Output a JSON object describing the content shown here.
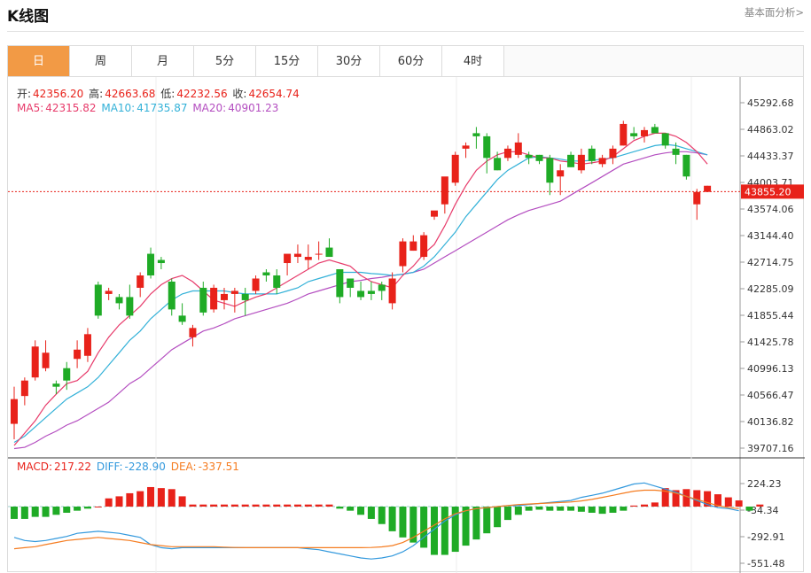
{
  "header": {
    "title": "K线图",
    "fundamental_link": "基本面分析>"
  },
  "tabs": [
    {
      "label": "日",
      "active": true
    },
    {
      "label": "周",
      "active": false
    },
    {
      "label": "月",
      "active": false
    },
    {
      "label": "5分",
      "active": false
    },
    {
      "label": "15分",
      "active": false
    },
    {
      "label": "30分",
      "active": false
    },
    {
      "label": "60分",
      "active": false
    },
    {
      "label": "4时",
      "active": false
    }
  ],
  "ohlc_info": {
    "open_label": "开:",
    "open": "42356.20",
    "high_label": "高:",
    "high": "42663.68",
    "low_label": "低:",
    "low": "42232.56",
    "close_label": "收:",
    "close": "42654.74"
  },
  "ma_info": {
    "ma5_label": "MA5:",
    "ma5": "42315.82",
    "ma10_label": "MA10:",
    "ma10": "41735.87",
    "ma20_label": "MA20:",
    "ma20": "40901.23"
  },
  "macd_info": {
    "macd_label": "MACD:",
    "macd": "217.22",
    "diff_label": "DIFF:",
    "diff": "-228.90",
    "dea_label": "DEA:",
    "dea": "-337.51"
  },
  "colors": {
    "up": "#e8221a",
    "down": "#1fab26",
    "ma5": "#e73b6b",
    "ma10": "#33b1d8",
    "ma20": "#b44ec0",
    "diff": "#3399dd",
    "dea": "#f57c20",
    "accent": "#f29a45"
  },
  "chart_data": [
    {
      "type": "candlestick",
      "price_ticks": [
        "45292.68",
        "44863.02",
        "44433.37",
        "44003.71",
        "43574.06",
        "43144.40",
        "42714.75",
        "42285.09",
        "41855.44",
        "41425.78",
        "40996.13",
        "40566.47",
        "40136.82",
        "39707.16"
      ],
      "ylim": [
        39707.16,
        45292.68
      ],
      "current_price": "43855.20",
      "candles": [
        [
          40100,
          40700,
          39850,
          40500
        ],
        [
          40550,
          40850,
          40400,
          40800
        ],
        [
          40850,
          41450,
          40800,
          41350
        ],
        [
          41000,
          41450,
          40950,
          41250
        ],
        [
          40750,
          40800,
          40580,
          40700
        ],
        [
          41000,
          41100,
          40650,
          40800
        ],
        [
          41150,
          41450,
          41000,
          41300
        ],
        [
          41200,
          41650,
          41100,
          41550
        ],
        [
          42350,
          42400,
          41800,
          41850
        ],
        [
          42200,
          42300,
          42100,
          42250
        ],
        [
          42150,
          42200,
          41950,
          42050
        ],
        [
          42150,
          42350,
          41800,
          41850
        ],
        [
          42300,
          42550,
          42150,
          42500
        ],
        [
          42850,
          42950,
          42450,
          42500
        ],
        [
          42750,
          42800,
          42600,
          42700
        ],
        [
          42400,
          42450,
          41850,
          41950
        ],
        [
          41850,
          42050,
          41700,
          41750
        ],
        [
          41500,
          41700,
          41350,
          41650
        ],
        [
          42300,
          42400,
          41850,
          41900
        ],
        [
          41950,
          42350,
          41900,
          42300
        ],
        [
          42100,
          42300,
          41950,
          42200
        ],
        [
          42200,
          42300,
          41900,
          42250
        ],
        [
          42200,
          42300,
          41850,
          42100
        ],
        [
          42250,
          42500,
          42200,
          42450
        ],
        [
          42550,
          42600,
          42400,
          42500
        ],
        [
          42500,
          42600,
          42200,
          42300
        ],
        [
          42700,
          42750,
          42500,
          42850
        ],
        [
          42800,
          43000,
          42700,
          42850
        ],
        [
          42750,
          43000,
          42600,
          42800
        ],
        [
          42850,
          43050,
          42750,
          42850
        ],
        [
          42950,
          43100,
          42900,
          42800
        ],
        [
          42600,
          42600,
          42050,
          42150
        ],
        [
          42450,
          42450,
          42150,
          42300
        ],
        [
          42250,
          42400,
          42100,
          42150
        ],
        [
          42250,
          42400,
          42100,
          42200
        ],
        [
          42350,
          42400,
          42100,
          42250
        ],
        [
          42050,
          42550,
          41950,
          42450
        ],
        [
          42650,
          43100,
          42550,
          43050
        ],
        [
          42900,
          43150,
          42900,
          43050
        ],
        [
          42800,
          43200,
          42750,
          43150
        ],
        [
          43450,
          43500,
          43400,
          43550
        ],
        [
          43650,
          43750,
          43500,
          44100
        ],
        [
          44000,
          44500,
          43950,
          44450
        ],
        [
          44550,
          44650,
          44400,
          44600
        ],
        [
          44800,
          44900,
          44550,
          44750
        ],
        [
          44750,
          44800,
          44150,
          44400
        ],
        [
          44400,
          44500,
          44200,
          44200
        ],
        [
          44400,
          44600,
          44350,
          44550
        ],
        [
          44450,
          44800,
          44400,
          44650
        ],
        [
          44450,
          44500,
          44300,
          44400
        ],
        [
          44450,
          44450,
          44300,
          44350
        ],
        [
          44400,
          44450,
          43800,
          44000
        ],
        [
          44100,
          44300,
          43800,
          44200
        ],
        [
          44450,
          44500,
          44250,
          44250
        ],
        [
          44200,
          44550,
          44150,
          44450
        ],
        [
          44550,
          44600,
          44300,
          44350
        ],
        [
          44300,
          44450,
          44250,
          44400
        ],
        [
          44400,
          44600,
          44300,
          44550
        ],
        [
          44600,
          45000,
          44600,
          44950
        ],
        [
          44800,
          44900,
          44700,
          44750
        ],
        [
          44750,
          44900,
          44650,
          44850
        ],
        [
          44900,
          44950,
          44800,
          44800
        ],
        [
          44800,
          44800,
          44550,
          44600
        ],
        [
          44550,
          44650,
          44300,
          44450
        ],
        [
          44450,
          44450,
          44050,
          44100
        ],
        [
          43650,
          43900,
          43400,
          43850
        ],
        [
          43850,
          43950,
          43850,
          43950
        ]
      ],
      "ma5": [
        39750,
        39950,
        40150,
        40400,
        40580,
        40750,
        40800,
        40950,
        41250,
        41500,
        41700,
        41850,
        42000,
        42200,
        42350,
        42450,
        42500,
        42400,
        42250,
        42100,
        42050,
        42000,
        42080,
        42150,
        42200,
        42300,
        42400,
        42500,
        42600,
        42700,
        42750,
        42700,
        42650,
        42500,
        42400,
        42350,
        42300,
        42500,
        42650,
        42850,
        43000,
        43300,
        43650,
        43950,
        44200,
        44350,
        44450,
        44500,
        44500,
        44450,
        44400,
        44400,
        44350,
        44330,
        44300,
        44320,
        44350,
        44420,
        44550,
        44680,
        44750,
        44800,
        44800,
        44750,
        44650,
        44500,
        44300
      ],
      "ma10": [
        39800,
        39900,
        40050,
        40200,
        40350,
        40500,
        40600,
        40700,
        40850,
        41050,
        41250,
        41450,
        41600,
        41800,
        41950,
        42100,
        42200,
        42250,
        42250,
        42250,
        42250,
        42220,
        42200,
        42200,
        42200,
        42200,
        42250,
        42300,
        42400,
        42450,
        42500,
        42550,
        42550,
        42550,
        42530,
        42520,
        42500,
        42520,
        42550,
        42650,
        42800,
        43000,
        43200,
        43450,
        43650,
        43850,
        44050,
        44200,
        44300,
        44400,
        44420,
        44400,
        44380,
        44350,
        44350,
        44360,
        44380,
        44400,
        44450,
        44500,
        44550,
        44600,
        44620,
        44600,
        44550,
        44500,
        44450
      ],
      "ma20": [
        39700,
        39720,
        39800,
        39900,
        39980,
        40080,
        40150,
        40250,
        40350,
        40450,
        40600,
        40750,
        40850,
        41000,
        41150,
        41300,
        41400,
        41500,
        41600,
        41650,
        41720,
        41800,
        41850,
        41900,
        41950,
        42000,
        42050,
        42120,
        42200,
        42250,
        42300,
        42350,
        42400,
        42420,
        42450,
        42470,
        42500,
        42520,
        42550,
        42600,
        42700,
        42800,
        42900,
        43000,
        43100,
        43200,
        43300,
        43400,
        43480,
        43550,
        43600,
        43650,
        43700,
        43800,
        43900,
        44000,
        44100,
        44200,
        44300,
        44350,
        44400,
        44450,
        44480,
        44500,
        44500,
        44480,
        44450
      ]
    },
    {
      "type": "macd",
      "ticks": [
        "224.23",
        "-34.34",
        "-292.91",
        "-551.48"
      ],
      "ylim": [
        -551.48,
        224.23
      ],
      "macd": [
        -120,
        -120,
        -100,
        -100,
        -80,
        -60,
        -40,
        -20,
        0,
        80,
        100,
        130,
        150,
        190,
        180,
        170,
        100,
        20,
        20,
        20,
        20,
        20,
        20,
        20,
        20,
        20,
        20,
        20,
        20,
        20,
        20,
        -20,
        -40,
        -80,
        -120,
        -170,
        -240,
        -300,
        -350,
        -400,
        -470,
        -470,
        -440,
        -380,
        -320,
        -260,
        -200,
        -130,
        -80,
        -40,
        -30,
        -40,
        -40,
        -40,
        -50,
        -60,
        -70,
        -60,
        -40,
        10,
        20,
        40,
        180,
        160,
        170,
        160,
        150,
        120,
        90,
        60,
        -40,
        20
      ],
      "diff": [
        -300,
        -330,
        -340,
        -330,
        -310,
        -290,
        -260,
        -250,
        -240,
        -250,
        -260,
        -280,
        -300,
        -370,
        -400,
        -410,
        -400,
        -400,
        -400,
        -400,
        -400,
        -400,
        -400,
        -400,
        -400,
        -400,
        -400,
        -400,
        -410,
        -420,
        -440,
        -460,
        -480,
        -500,
        -510,
        -500,
        -480,
        -440,
        -380,
        -300,
        -220,
        -140,
        -80,
        -40,
        -20,
        -10,
        0,
        10,
        10,
        20,
        30,
        40,
        50,
        60,
        90,
        110,
        130,
        160,
        190,
        220,
        230,
        200,
        170,
        140,
        100,
        60,
        20,
        -10,
        -20,
        -40
      ],
      "dea": [
        -410,
        -400,
        -390,
        -370,
        -350,
        -330,
        -320,
        -310,
        -300,
        -310,
        -320,
        -330,
        -350,
        -370,
        -380,
        -390,
        -390,
        -390,
        -390,
        -390,
        -395,
        -398,
        -400,
        -400,
        -400,
        -400,
        -400,
        -400,
        -400,
        -400,
        -400,
        -400,
        -400,
        -400,
        -398,
        -392,
        -380,
        -350,
        -300,
        -240,
        -180,
        -120,
        -70,
        -40,
        -20,
        -10,
        0,
        10,
        20,
        25,
        30,
        35,
        40,
        45,
        55,
        70,
        90,
        110,
        130,
        150,
        160,
        160,
        150,
        130,
        100,
        70,
        40,
        10,
        -10,
        -20
      ]
    }
  ]
}
